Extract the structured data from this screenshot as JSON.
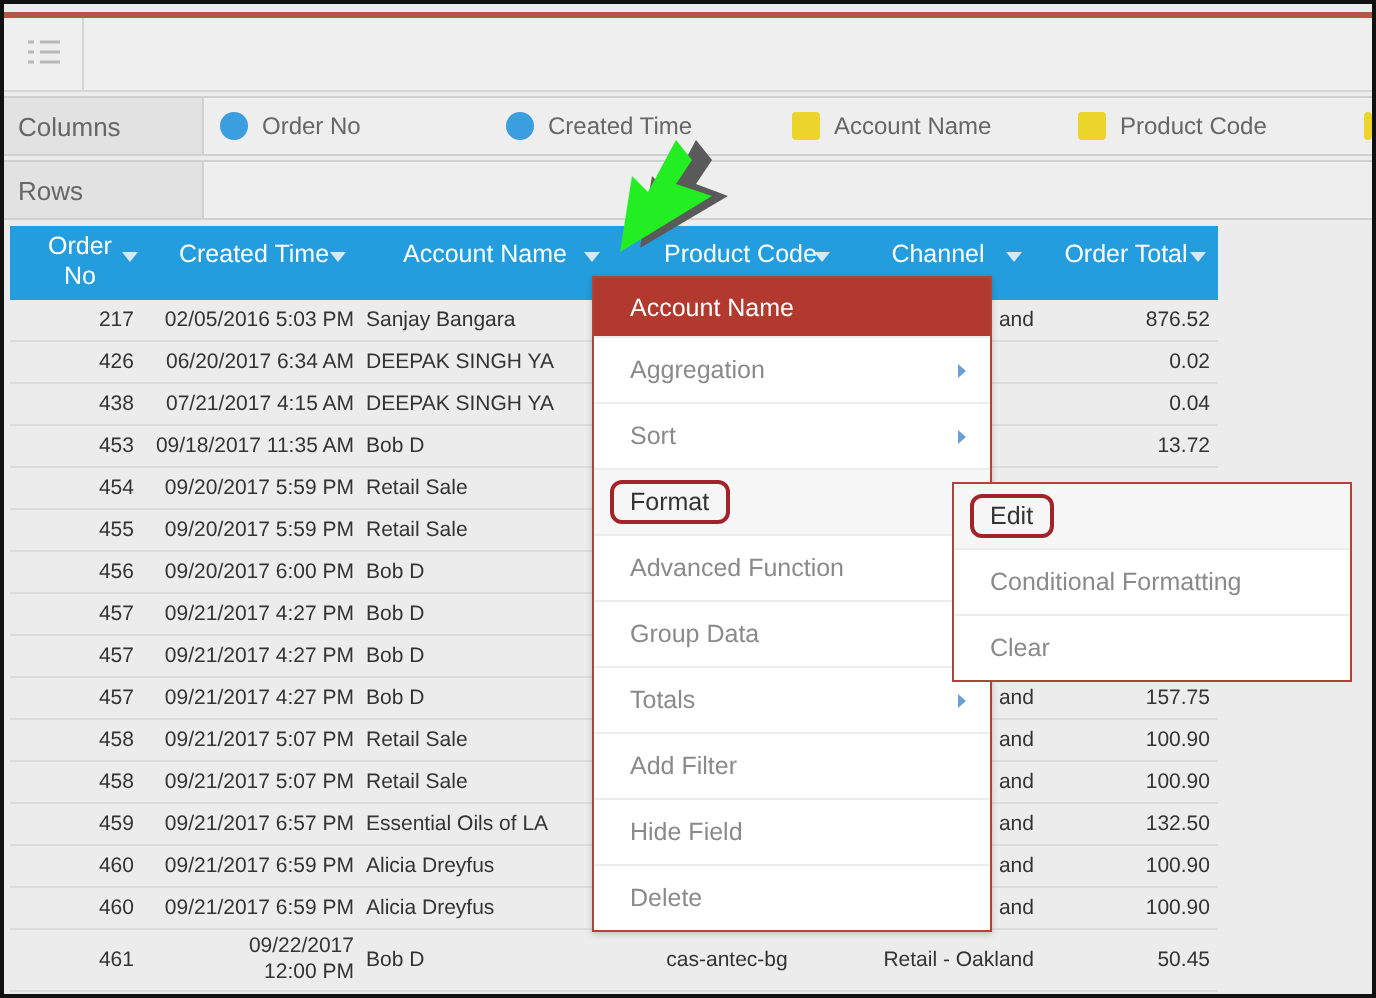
{
  "fields_bar": {
    "columns_label": "Columns",
    "rows_label": "Rows",
    "columns": [
      {
        "label": "Order No",
        "kind": "circle",
        "color": "#3b9ede"
      },
      {
        "label": "Created Time",
        "kind": "circle",
        "color": "#3b9ede"
      },
      {
        "label": "Account Name",
        "kind": "square",
        "color": "#ecd52a"
      },
      {
        "label": "Product Code",
        "kind": "square",
        "color": "#ecd52a"
      }
    ]
  },
  "table": {
    "columns": [
      "Order No",
      "Created Time",
      "Account Name",
      "Product Code",
      "Channel",
      "Order Total"
    ],
    "rows": [
      [
        "217",
        "02/05/2016 5:03 PM",
        "Sanjay Bangara",
        "",
        "and",
        "876.52"
      ],
      [
        "426",
        "06/20/2017 6:34 AM",
        "DEEPAK SINGH YA",
        "",
        "",
        "0.02"
      ],
      [
        "438",
        "07/21/2017 4:15 AM",
        "DEEPAK SINGH YA",
        "",
        "",
        "0.04"
      ],
      [
        "453",
        "09/18/2017 11:35 AM",
        "Bob D",
        "",
        "",
        "13.72"
      ],
      [
        "454",
        "09/20/2017 5:59 PM",
        "Retail Sale",
        "",
        "",
        ""
      ],
      [
        "455",
        "09/20/2017 5:59 PM",
        "Retail Sale",
        "",
        "",
        ""
      ],
      [
        "456",
        "09/20/2017 6:00 PM",
        "Bob D",
        "",
        "",
        ""
      ],
      [
        "457",
        "09/21/2017 4:27 PM",
        "Bob D",
        "",
        "",
        ""
      ],
      [
        "457",
        "09/21/2017 4:27 PM",
        "Bob D",
        "",
        "",
        ""
      ],
      [
        "457",
        "09/21/2017 4:27 PM",
        "Bob D",
        "",
        "and",
        "157.75"
      ],
      [
        "458",
        "09/21/2017 5:07 PM",
        "Retail Sale",
        "",
        "and",
        "100.90"
      ],
      [
        "458",
        "09/21/2017 5:07 PM",
        "Retail Sale",
        "",
        "and",
        "100.90"
      ],
      [
        "459",
        "09/21/2017 6:57 PM",
        "Essential Oils of LA",
        "",
        "and",
        "132.50"
      ],
      [
        "460",
        "09/21/2017 6:59 PM",
        "Alicia Dreyfus",
        "",
        "and",
        "100.90"
      ],
      [
        "460",
        "09/21/2017 6:59 PM",
        "Alicia Dreyfus",
        "",
        "and",
        "100.90"
      ],
      [
        "461",
        "09/22/2017 12:00 PM",
        "Bob D",
        "cas-antec-bg",
        "Retail - Oakland",
        "50.45"
      ]
    ]
  },
  "context_menu": {
    "title": "Account Name",
    "items": [
      {
        "label": "Aggregation",
        "has_submenu": true,
        "highlighted": false
      },
      {
        "label": "Sort",
        "has_submenu": true,
        "highlighted": false
      },
      {
        "label": "Format",
        "has_submenu": false,
        "highlighted": true
      },
      {
        "label": "Advanced Function",
        "has_submenu": false,
        "highlighted": false
      },
      {
        "label": "Group Data",
        "has_submenu": false,
        "highlighted": false
      },
      {
        "label": "Totals",
        "has_submenu": true,
        "highlighted": false
      },
      {
        "label": "Add Filter",
        "has_submenu": false,
        "highlighted": false
      },
      {
        "label": "Hide Field",
        "has_submenu": false,
        "highlighted": false
      },
      {
        "label": "Delete",
        "has_submenu": false,
        "highlighted": false
      }
    ]
  },
  "submenu": {
    "items": [
      {
        "label": "Edit",
        "highlighted": true
      },
      {
        "label": "Conditional Formatting",
        "highlighted": false
      },
      {
        "label": "Clear",
        "highlighted": false
      }
    ]
  }
}
